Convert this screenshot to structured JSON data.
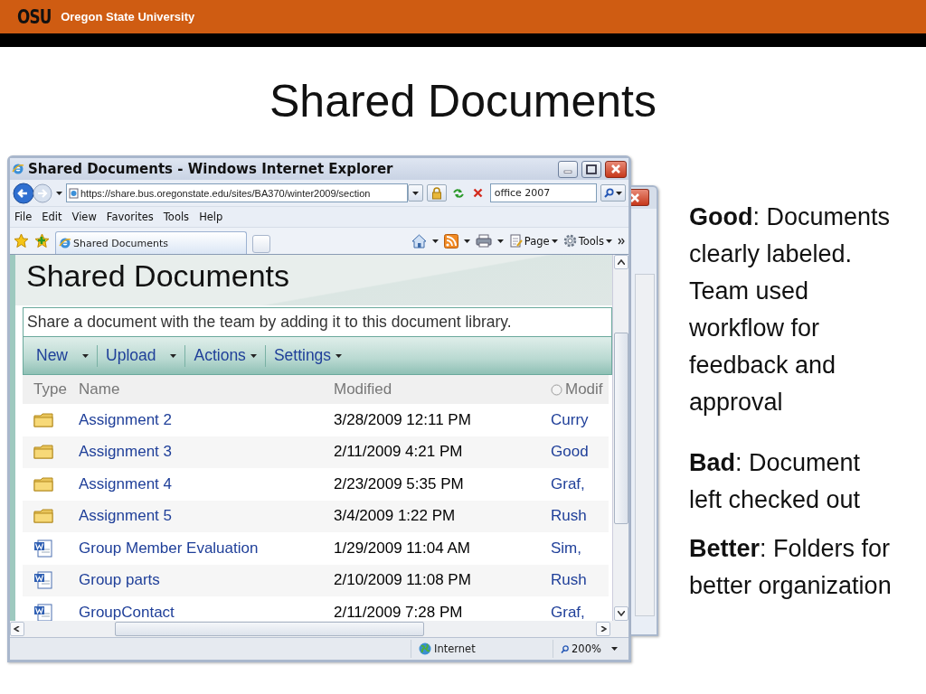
{
  "header": {
    "logo": "OSU",
    "brand": "Oregon State University"
  },
  "title": "Shared Documents",
  "browser": {
    "title": "Shared Documents - Windows Internet Explorer",
    "address": "https://share.bus.oregonstate.edu/sites/BA370/winter2009/section",
    "search": {
      "value": "office 2007"
    },
    "menu": [
      "File",
      "Edit",
      "View",
      "Favorites",
      "Tools",
      "Help"
    ],
    "tab": "Shared Documents",
    "toolbar": [
      "Page",
      "Tools"
    ],
    "page_title": "Shared Documents",
    "description": "Share a document with the team by adding it to this document library.",
    "actions": [
      {
        "label": "New",
        "kind": "split"
      },
      {
        "label": "Upload",
        "kind": "split"
      },
      {
        "label": "Actions",
        "kind": "menu"
      },
      {
        "label": "Settings",
        "kind": "menu"
      }
    ],
    "columns": [
      "Type",
      "Name",
      "Modified",
      "Modif"
    ],
    "rows": [
      {
        "kind": "folder",
        "name": "Assignment 2",
        "modified": "3/28/2009 12:11 PM",
        "column_4": "Curry"
      },
      {
        "kind": "folder",
        "name": "Assignment 3",
        "modified": "2/11/2009 4:21 PM",
        "column_4": "Good"
      },
      {
        "kind": "folder",
        "name": "Assignment 4",
        "modified": "2/23/2009 5:35 PM",
        "column_4": "Graf,"
      },
      {
        "kind": "folder",
        "name": "Assignment 5",
        "modified": "3/4/2009 1:22 PM",
        "column_4": "Rush"
      },
      {
        "kind": "document",
        "name": "Group Member Evaluation",
        "modified": "1/29/2009 11:04 AM",
        "column_4": "Sim,"
      },
      {
        "kind": "document",
        "name": "Group parts",
        "modified": "2/10/2009 11:08 PM",
        "column_4": "Rush"
      },
      {
        "kind": "document",
        "name": "GroupContact",
        "modified": "2/11/2009 7:28 PM",
        "column_4": "Graf,"
      }
    ],
    "status": {
      "zone": "Internet",
      "zoom": "200%"
    }
  },
  "notes": [
    {
      "text": "**Good**: Documents clearly labeled. Team used workflow for feedback and approval"
    },
    {
      "text": "**Bad**: Document left checked out"
    },
    {
      "text": "**Better**: Folders for better organization"
    }
  ]
}
